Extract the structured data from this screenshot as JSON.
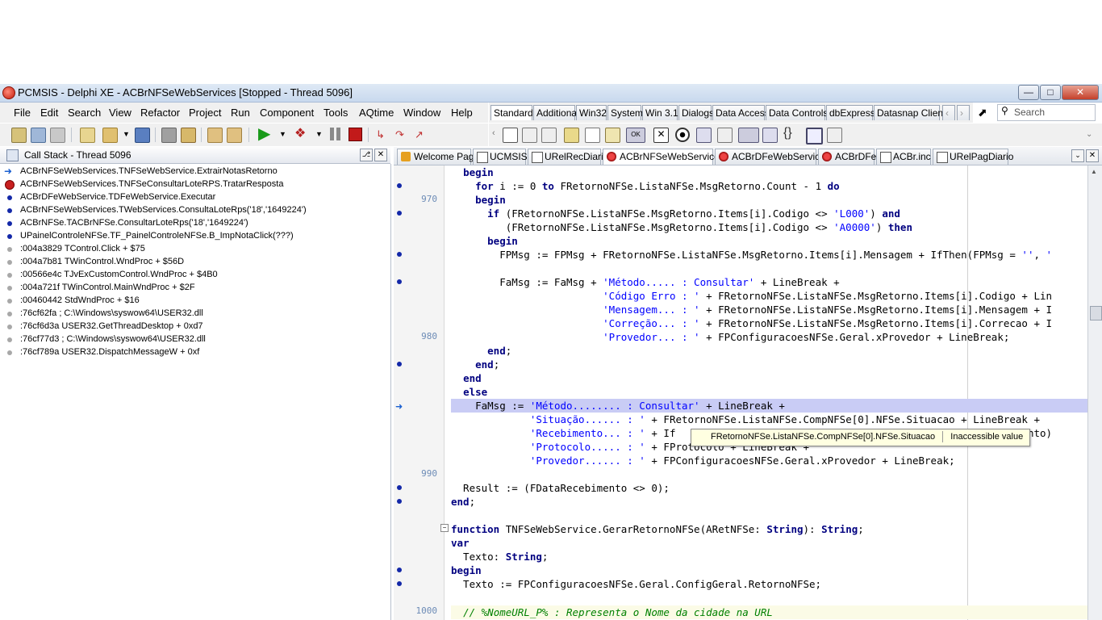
{
  "window": {
    "title": "PCMSIS - Delphi XE - ACBrNFSeWebServices [Stopped - Thread 5096]"
  },
  "menu": [
    "File",
    "Edit",
    "Search",
    "View",
    "Refactor",
    "Project",
    "Run",
    "Component",
    "Tools",
    "AQtime",
    "Window",
    "Help"
  ],
  "palette_tabs": [
    "Standard",
    "Additional",
    "Win32",
    "System",
    "Win 3.1",
    "Dialogs",
    "Data Access",
    "Data Controls",
    "dbExpress",
    "Datasnap Client"
  ],
  "search": {
    "placeholder": "Search"
  },
  "callstack": {
    "title": "Call Stack - Thread 5096",
    "rows": [
      "ACBrNFSeWebServices.TNFSeWebService.ExtrairNotasRetorno",
      "ACBrNFSeWebServices.TNFSeConsultarLoteRPS.TratarResposta",
      "ACBrDFeWebService.TDFeWebService.Executar",
      "ACBrNFSeWebServices.TWebServices.ConsultaLoteRps('18','1649224')",
      "ACBrNFSe.TACBrNFSe.ConsultarLoteRps('18','1649224')",
      "UPainelControleNFSe.TF_PainelControleNFSe.B_ImpNotaClick(???)",
      ":004a3829 TControl.Click + $75",
      ":004a7b81 TWinControl.WndProc + $56D",
      ":00566e4c TJvExCustomControl.WndProc + $4B0",
      ":004a721f TWinControl.MainWndProc + $2F",
      ":00460442 StdWndProc + $16",
      ":76cf62fa ; C:\\Windows\\syswow64\\USER32.dll",
      ":76cf6d3a USER32.GetThreadDesktop + 0xd7",
      ":76cf77d3 ; C:\\Windows\\syswow64\\USER32.dll",
      ":76cf789a USER32.DispatchMessageW + 0xf"
    ]
  },
  "editor_tabs": [
    "Welcome Page",
    "UCMSIS",
    "URelRecDiario",
    "ACBrNFSeWebServices",
    "ACBrDFeWebService",
    "ACBrDFe",
    "ACBr.inc",
    "URelPagDiario"
  ],
  "line_numbers": [
    "970",
    "980",
    "990",
    "1000"
  ],
  "tooltip": {
    "expr": "FRetornoNFSe.ListaNFSe.CompNFSe[0].NFSe.Situacao",
    "value": "Inaccessible value"
  }
}
